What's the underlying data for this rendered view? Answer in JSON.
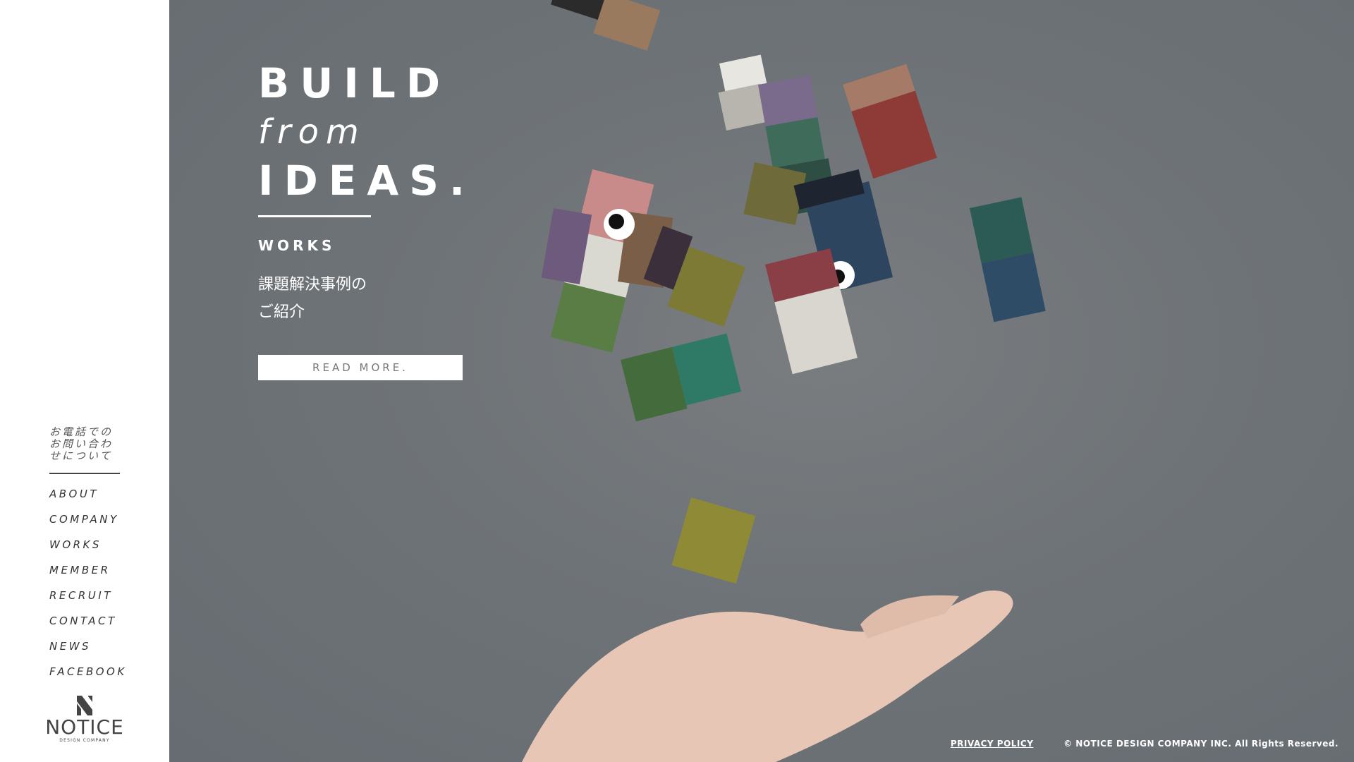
{
  "sidebar": {
    "phone_inquiry": "お電話での\nお問い合わ\nせについて",
    "nav": [
      "ABOUT",
      "COMPANY",
      "WORKS",
      "MEMBER",
      "RECRUIT",
      "CONTACT",
      "NEWS",
      "FACEBOOK"
    ],
    "logo": {
      "name": "NOTICE",
      "subtitle": "DESIGN COMPANY"
    }
  },
  "hero": {
    "headline": {
      "line1": "BUILD",
      "line2": "from",
      "line3": "IDEAS."
    },
    "section_label": "WORKS",
    "description": "課題解決事例の\nご紹介",
    "cta_label": "READ MORE."
  },
  "footer": {
    "privacy_link": "PRIVACY POLICY",
    "copyright": "© NOTICE DESIGN COMPANY INC. All Rights Reserved."
  },
  "colors": {
    "hero_bg": "#6e7377",
    "sidebar_bg": "#ffffff",
    "text_dark": "#333333"
  }
}
